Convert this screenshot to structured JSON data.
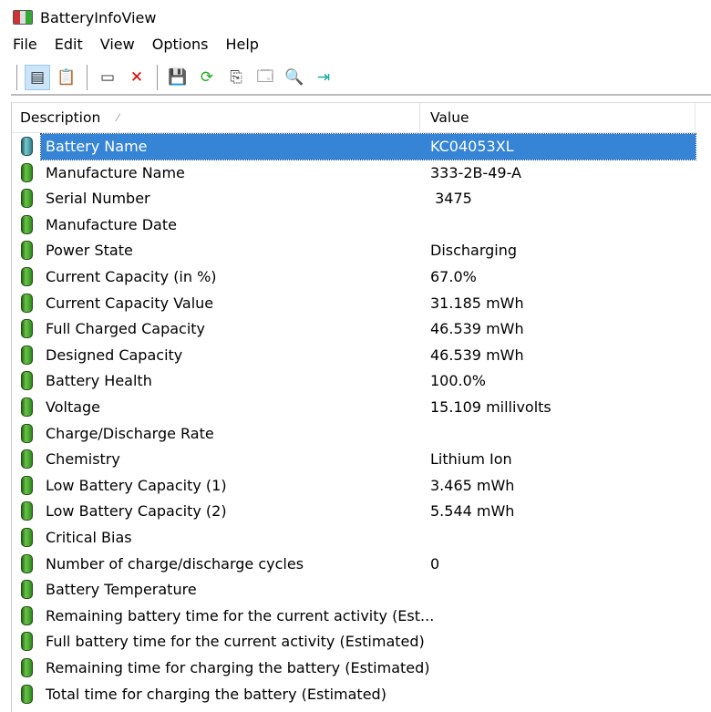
{
  "window": {
    "title": "BatteryInfoView"
  },
  "menu": [
    "File",
    "Edit",
    "View",
    "Options",
    "Help"
  ],
  "toolbar": [
    {
      "name": "html-report-selected-icon",
      "glyph": "▤"
    },
    {
      "name": "html-report-all-icon",
      "glyph": "📋"
    },
    {
      "name": "properties-window-icon",
      "glyph": "▭"
    },
    {
      "name": "delete-icon",
      "glyph": "✕"
    },
    {
      "name": "save-icon",
      "glyph": "💾"
    },
    {
      "name": "refresh-icon",
      "glyph": "⟳"
    },
    {
      "name": "copy-icon",
      "glyph": "⎘"
    },
    {
      "name": "properties-icon",
      "glyph": "🗔"
    },
    {
      "name": "find-icon",
      "glyph": "🔍"
    },
    {
      "name": "exit-icon",
      "glyph": "⇥"
    }
  ],
  "columns": {
    "description": "Description",
    "value": "Value",
    "sort_indicator": "⁄"
  },
  "rows": [
    {
      "d": "Battery Name",
      "v": "KC04053XL"
    },
    {
      "d": "Manufacture Name",
      "v": "333-2B-49-A"
    },
    {
      "d": "Serial Number",
      "v": " 3475"
    },
    {
      "d": "Manufacture Date",
      "v": ""
    },
    {
      "d": "Power State",
      "v": "Discharging"
    },
    {
      "d": "Current Capacity (in %)",
      "v": "67.0%"
    },
    {
      "d": "Current Capacity Value",
      "v": "31.185 mWh"
    },
    {
      "d": "Full Charged Capacity",
      "v": "46.539 mWh"
    },
    {
      "d": "Designed Capacity",
      "v": "46.539 mWh"
    },
    {
      "d": "Battery Health",
      "v": "100.0%"
    },
    {
      "d": "Voltage",
      "v": "15.109 millivolts"
    },
    {
      "d": "Charge/Discharge Rate",
      "v": ""
    },
    {
      "d": "Chemistry",
      "v": "Lithium Ion"
    },
    {
      "d": "Low Battery Capacity (1)",
      "v": "3.465 mWh"
    },
    {
      "d": "Low Battery Capacity (2)",
      "v": "5.544 mWh"
    },
    {
      "d": "Critical Bias",
      "v": ""
    },
    {
      "d": "Number of charge/discharge cycles",
      "v": "0"
    },
    {
      "d": "Battery Temperature",
      "v": ""
    },
    {
      "d": "Remaining battery time for the current activity (Est...",
      "v": ""
    },
    {
      "d": "Full battery time for the current activity (Estimated)",
      "v": ""
    },
    {
      "d": "Remaining time for charging the battery (Estimated)",
      "v": ""
    },
    {
      "d": "Total  time for charging the battery (Estimated)",
      "v": ""
    }
  ],
  "selected_row": 0
}
